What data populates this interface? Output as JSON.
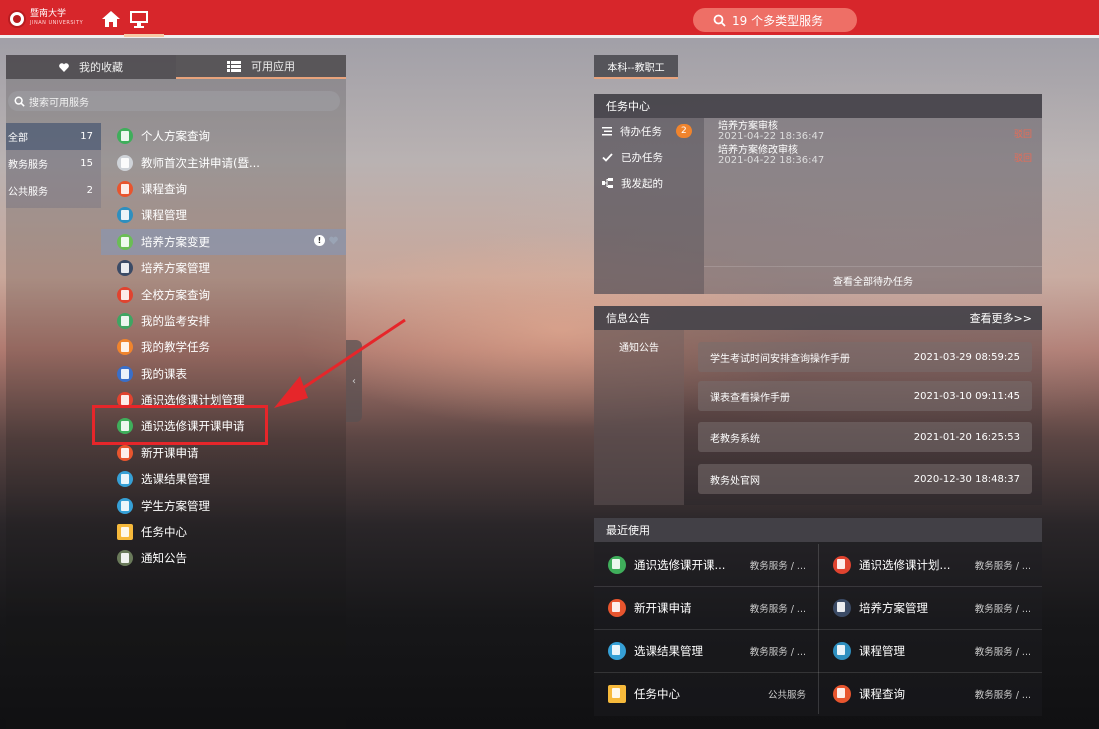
{
  "header": {
    "logo_text": "暨南大学",
    "logo_sub": "JINAN UNIVERSITY",
    "search_label": "19 个多类型服务"
  },
  "left": {
    "tabs": [
      {
        "label": "我的收藏",
        "icon": "heart-icon"
      },
      {
        "label": "可用应用",
        "icon": "list-icon"
      }
    ],
    "search_placeholder": "搜索可用服务",
    "categories": [
      {
        "label": "全部",
        "count": "17"
      },
      {
        "label": "教务服务",
        "count": "15"
      },
      {
        "label": "公共服务",
        "count": "2"
      }
    ],
    "apps": [
      {
        "label": "个人方案查询",
        "color": "#3fae5b"
      },
      {
        "label": "教师首次主讲申请(暨...",
        "color": "#cfd3d8"
      },
      {
        "label": "课程查询",
        "color": "#e8552e"
      },
      {
        "label": "课程管理",
        "color": "#2e8fbf"
      },
      {
        "label": "培养方案变更",
        "color": "#6bbd55"
      },
      {
        "label": "培养方案管理",
        "color": "#3b4b66"
      },
      {
        "label": "全校方案查询",
        "color": "#e0432f"
      },
      {
        "label": "我的监考安排",
        "color": "#3fa563"
      },
      {
        "label": "我的教学任务",
        "color": "#f0842d"
      },
      {
        "label": "我的课表",
        "color": "#3a6fc9"
      },
      {
        "label": "通识选修课计划管理",
        "color": "#e0432f"
      },
      {
        "label": "通识选修课开课申请",
        "color": "#3fae5b"
      },
      {
        "label": "新开课申请",
        "color": "#e8552e"
      },
      {
        "label": "选课结果管理",
        "color": "#36a0d6"
      },
      {
        "label": "学生方案管理",
        "color": "#36a0d6"
      },
      {
        "label": "任务中心",
        "color": "#f6b93b"
      },
      {
        "label": "通知公告",
        "color": "#6a7a5a"
      }
    ]
  },
  "right": {
    "role_tab": "本科--教职工",
    "task_center": {
      "title": "任务中心",
      "menu": [
        {
          "label": "待办任务",
          "badge": "2"
        },
        {
          "label": "已办任务"
        },
        {
          "label": "我发起的"
        }
      ],
      "items": [
        {
          "title": "培养方案审核",
          "time": "2021-04-22 18:36:47",
          "action": "驳回"
        },
        {
          "title": "培养方案修改审核",
          "time": "2021-04-22 18:36:47",
          "action": "驳回"
        }
      ],
      "footer": "查看全部待办任务"
    },
    "notice": {
      "title": "信息公告",
      "more": "查看更多>>",
      "category": "通知公告",
      "rows": [
        {
          "title": "学生考试时间安排查询操作手册",
          "date": "2021-03-29 08:59:25"
        },
        {
          "title": "课表查看操作手册",
          "date": "2021-03-10 09:11:45"
        },
        {
          "title": "老教务系统",
          "date": "2021-01-20 16:25:53"
        },
        {
          "title": "教务处官网",
          "date": "2020-12-30 18:48:37"
        }
      ]
    },
    "recent": {
      "title": "最近使用",
      "items": [
        {
          "label": "通识选修课开课...",
          "cat": "教务服务 / ...",
          "color": "#3fae5b"
        },
        {
          "label": "通识选修课计划...",
          "cat": "教务服务 / ...",
          "color": "#e0432f"
        },
        {
          "label": "新开课申请",
          "cat": "教务服务 / ...",
          "color": "#e8552e"
        },
        {
          "label": "培养方案管理",
          "cat": "教务服务 / ...",
          "color": "#3b4b66"
        },
        {
          "label": "选课结果管理",
          "cat": "教务服务 / ...",
          "color": "#36a0d6"
        },
        {
          "label": "课程管理",
          "cat": "教务服务 / ...",
          "color": "#2e8fbf"
        },
        {
          "label": "任务中心",
          "cat": "公共服务",
          "color": "#f6b93b"
        },
        {
          "label": "课程查询",
          "cat": "教务服务 / ...",
          "color": "#e8552e"
        }
      ]
    }
  },
  "colors": {
    "header_red": "#d7262b",
    "accent": "#e8a37c",
    "annotation_red": "#e6262a",
    "badge_orange": "#f0842d"
  }
}
